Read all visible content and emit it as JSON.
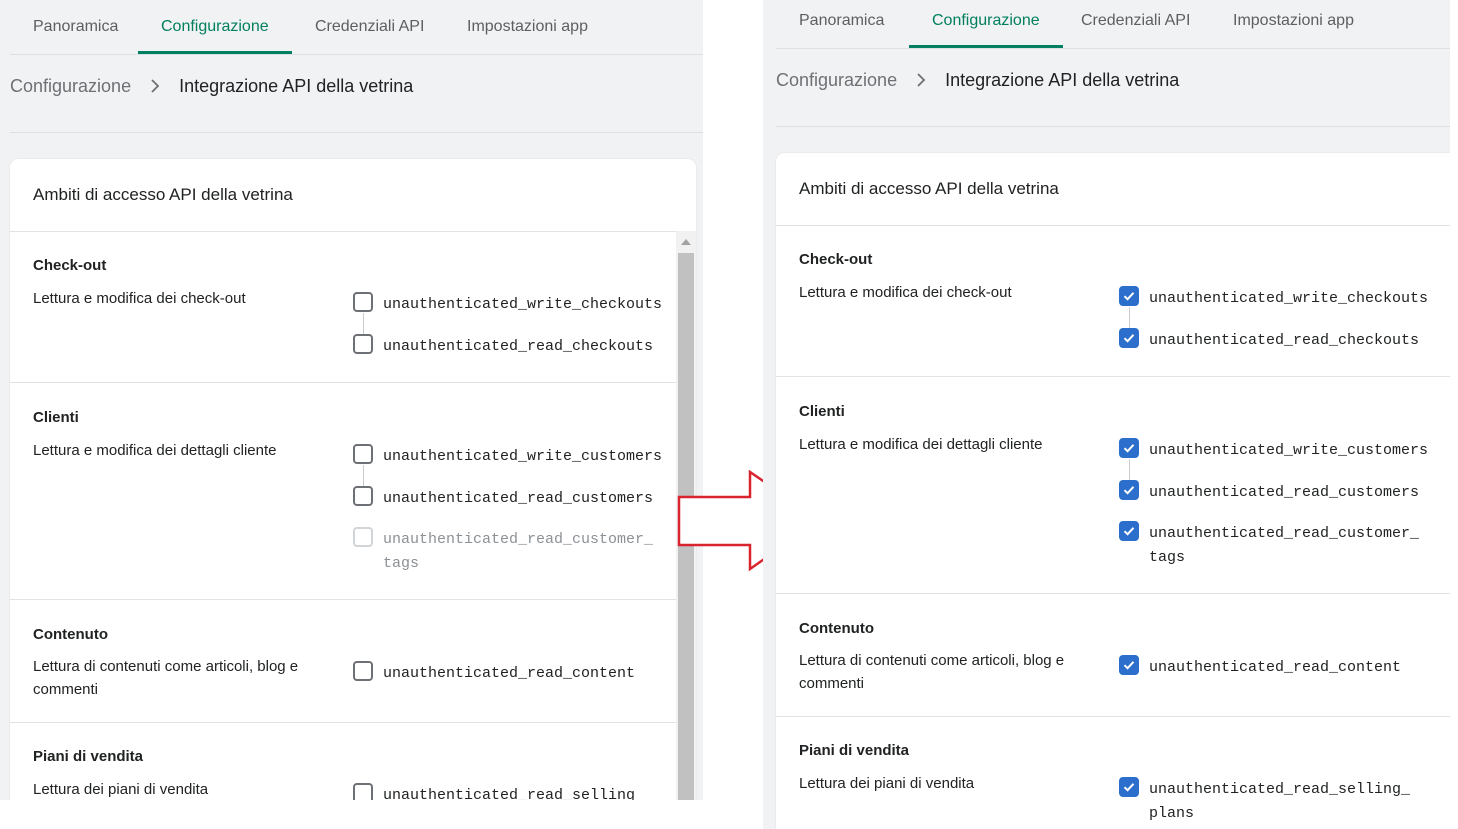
{
  "tabs": [
    "Panoramica",
    "Configurazione",
    "Credenziali API",
    "Impostazioni app"
  ],
  "breadcrumb": {
    "parent": "Configurazione",
    "current": "Integrazione API della vetrina"
  },
  "card_title": "Ambiti di accesso API della vetrina",
  "sections": {
    "checkout": {
      "title": "Check-out",
      "desc": "Lettura e modifica dei check-out",
      "scopes": [
        "unauthenticated_write_checkouts",
        "unauthenticated_read_checkouts"
      ]
    },
    "customers": {
      "title": "Clienti",
      "desc": "Lettura e modifica dei dettagli cliente",
      "scopes": [
        "unauthenticated_write_customers",
        "unauthenticated_read_customers"
      ],
      "tags_scope_line1": "unauthenticated_read_customer_",
      "tags_scope_line2": "tags"
    },
    "content": {
      "title": "Contenuto",
      "desc": "Lettura di contenuti come articoli, blog e commenti",
      "scope": "unauthenticated_read_content"
    },
    "selling": {
      "title": "Piani di vendita",
      "desc": "Lettura dei piani di vendita",
      "scope_left": "unauthenticated_read_selling",
      "scope_right_line1": "unauthenticated_read_selling_",
      "scope_right_line2": "plans"
    }
  },
  "state": {
    "left": {
      "checked": false,
      "customer_tags_disabled": true
    },
    "right": {
      "checked": true
    }
  },
  "colors": {
    "accent": "#008060",
    "checkbox": "#2c6ecb",
    "arrow": "#d9232f"
  },
  "icons": {
    "breadcrumb_sep": "chevron-right-icon",
    "check": "checkmark-icon",
    "transition": "arrow-right-icon"
  }
}
